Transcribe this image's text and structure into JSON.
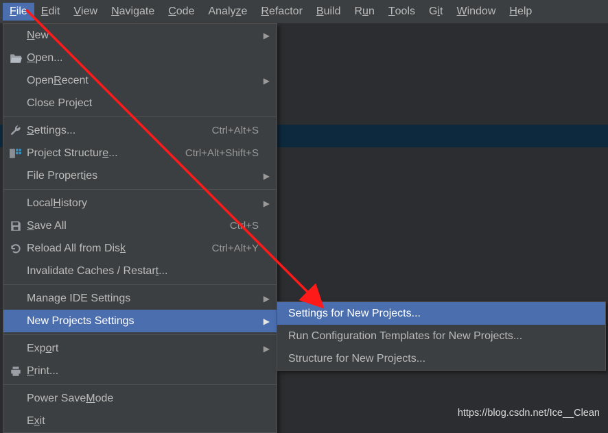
{
  "menubar": {
    "file": {
      "pre": "",
      "u": "F",
      "post": "ile"
    },
    "edit": {
      "pre": "",
      "u": "E",
      "post": "dit"
    },
    "view": {
      "pre": "",
      "u": "V",
      "post": "iew"
    },
    "navigate": {
      "pre": "",
      "u": "N",
      "post": "avigate"
    },
    "code": {
      "pre": "",
      "u": "C",
      "post": "ode"
    },
    "analyze": {
      "pre": "Analy",
      "u": "z",
      "post": "e"
    },
    "refactor": {
      "pre": "",
      "u": "R",
      "post": "efactor"
    },
    "build": {
      "pre": "",
      "u": "B",
      "post": "uild"
    },
    "run": {
      "pre": "R",
      "u": "u",
      "post": "n"
    },
    "tools": {
      "pre": "",
      "u": "T",
      "post": "ools"
    },
    "git": {
      "pre": "G",
      "u": "i",
      "post": "t"
    },
    "window": {
      "pre": "",
      "u": "W",
      "post": "indow"
    },
    "help": {
      "pre": "",
      "u": "H",
      "post": "elp"
    }
  },
  "file_menu": {
    "new": {
      "pre": "",
      "u": "N",
      "post": "ew",
      "arrow": true
    },
    "open": {
      "pre": "",
      "u": "O",
      "post": "pen...",
      "icon": "open"
    },
    "open_recent": {
      "pre": "Open ",
      "u": "R",
      "post": "ecent",
      "arrow": true
    },
    "close_project": {
      "pre": "Close Pro",
      "u": "j",
      "post": "ect"
    },
    "settings": {
      "pre": "",
      "u": "S",
      "post": "ettings...",
      "sc": "Ctrl+Alt+S",
      "icon": "wrench"
    },
    "project_structure": {
      "pre": "Project Structur",
      "u": "e",
      "post": "...",
      "sc": "Ctrl+Alt+Shift+S",
      "icon": "structure"
    },
    "file_properties": {
      "pre": "File Propert",
      "u": "i",
      "post": "es",
      "arrow": true
    },
    "local_history": {
      "pre": "Local ",
      "u": "H",
      "post": "istory",
      "arrow": true
    },
    "save_all": {
      "pre": "",
      "u": "S",
      "post": "ave All",
      "sc": "Ctrl+S",
      "icon": "save"
    },
    "reload": {
      "pre": "Reload All from Dis",
      "u": "k",
      "post": "",
      "sc": "Ctrl+Alt+Y",
      "icon": "reload"
    },
    "invalidate": {
      "pre": "Invalidate Caches / Restar",
      "u": "t",
      "post": "..."
    },
    "manage_ide": {
      "pre": "Mana",
      "u": "g",
      "post": "e IDE Settings",
      "arrow": true
    },
    "new_projects_settings": {
      "pre": "New Projects Settings",
      "u": "",
      "post": "",
      "arrow": true
    },
    "export": {
      "pre": "Exp",
      "u": "o",
      "post": "rt",
      "arrow": true
    },
    "print": {
      "pre": "",
      "u": "P",
      "post": "rint...",
      "icon": "print"
    },
    "power_save": {
      "pre": "Power Save ",
      "u": "M",
      "post": "ode"
    },
    "exit": {
      "pre": "E",
      "u": "x",
      "post": "it"
    }
  },
  "submenu": {
    "settings_for_new": "Settings for New Projects...",
    "run_config": "Run Configuration Templates for New Projects...",
    "structure_for_new": "Structure for New Projects..."
  },
  "watermark": "https://blog.csdn.net/Ice__Clean"
}
